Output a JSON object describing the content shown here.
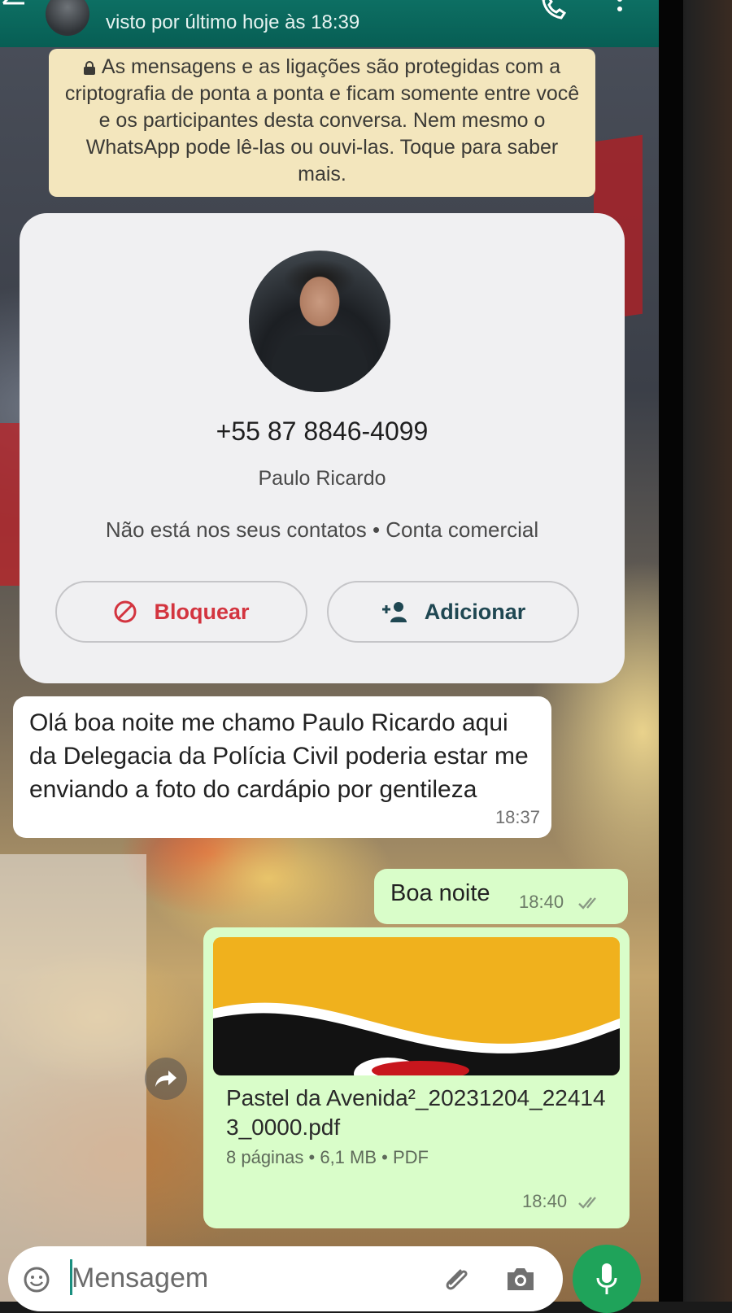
{
  "header": {
    "last_seen": "visto por último hoje às 18:39"
  },
  "encryption_notice": {
    "text": "As mensagens e as ligações são protegidas com a criptografia de ponta a ponta e ficam somente entre você e os participantes desta conversa. Nem mesmo o WhatsApp pode lê-las ou ouvi-las. Toque para saber mais."
  },
  "contact_card": {
    "phone": "+55 87 8846-4099",
    "name": "Paulo Ricardo",
    "status": "Não está nos seus contatos • Conta comercial",
    "block_label": "Bloquear",
    "add_label": "Adicionar"
  },
  "messages": [
    {
      "direction": "incoming",
      "text": "Olá boa noite me chamo Paulo Ricardo aqui da Delegacia da Polícia Civil poderia estar me enviando a foto do cardápio por gentileza",
      "time": "18:37"
    },
    {
      "direction": "outgoing",
      "text": "Boa noite",
      "time": "18:40",
      "status": "read"
    },
    {
      "direction": "outgoing",
      "type": "document",
      "file_name": "Pastel da Avenida²_20231204_224143_0000.pdf",
      "meta": "8 páginas • 6,1 MB • PDF",
      "time": "18:40",
      "status": "read"
    }
  ],
  "composer": {
    "placeholder": "Mensagem"
  },
  "colors": {
    "header": "#075e54",
    "outgoing_bubble": "#d9fdc9",
    "incoming_bubble": "#ffffff",
    "system_note": "#f3e6bd",
    "block_red": "#d3343f",
    "mic_green": "#1fa35a"
  },
  "icons": [
    "back-arrow-icon",
    "call-icon",
    "menu-icon",
    "lock-icon",
    "block-icon",
    "add-contact-icon",
    "double-check-icon",
    "forward-icon",
    "emoji-icon",
    "attach-icon",
    "camera-icon",
    "mic-icon"
  ]
}
